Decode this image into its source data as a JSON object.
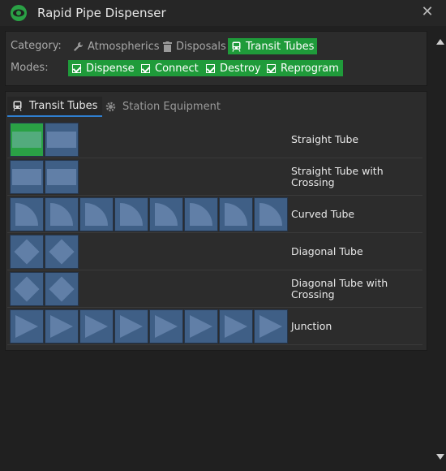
{
  "window": {
    "title": "Rapid Pipe Dispenser",
    "icons": {
      "app": "eye-icon",
      "close": "close-icon"
    }
  },
  "category": {
    "label": "Category:",
    "items": [
      {
        "label": "Atmospherics",
        "icon": "wrench-icon",
        "active": false
      },
      {
        "label": "Disposals",
        "icon": "trash-icon",
        "active": false
      },
      {
        "label": "Transit Tubes",
        "icon": "tram-icon",
        "active": true
      }
    ]
  },
  "modes": {
    "label": "Modes:",
    "items": [
      {
        "label": "Dispense",
        "checked": true
      },
      {
        "label": "Connect",
        "checked": true
      },
      {
        "label": "Destroy",
        "checked": true
      },
      {
        "label": "Reprogram",
        "checked": true
      }
    ]
  },
  "tabs": [
    {
      "label": "Transit Tubes",
      "icon": "tram-icon",
      "active": true
    },
    {
      "label": "Station Equipment",
      "icon": "gear-icon",
      "active": false
    }
  ],
  "items": [
    {
      "label": "Straight Tube"
    },
    {
      "label": "Straight Tube with Crossing"
    },
    {
      "label": "Curved Tube"
    },
    {
      "label": "Diagonal Tube"
    },
    {
      "label": "Diagonal Tube with Crossing"
    },
    {
      "label": "Junction"
    }
  ],
  "colors": {
    "accent": "#1f9b3a",
    "tab_underline": "#2f7fd0",
    "background": "#202020"
  }
}
